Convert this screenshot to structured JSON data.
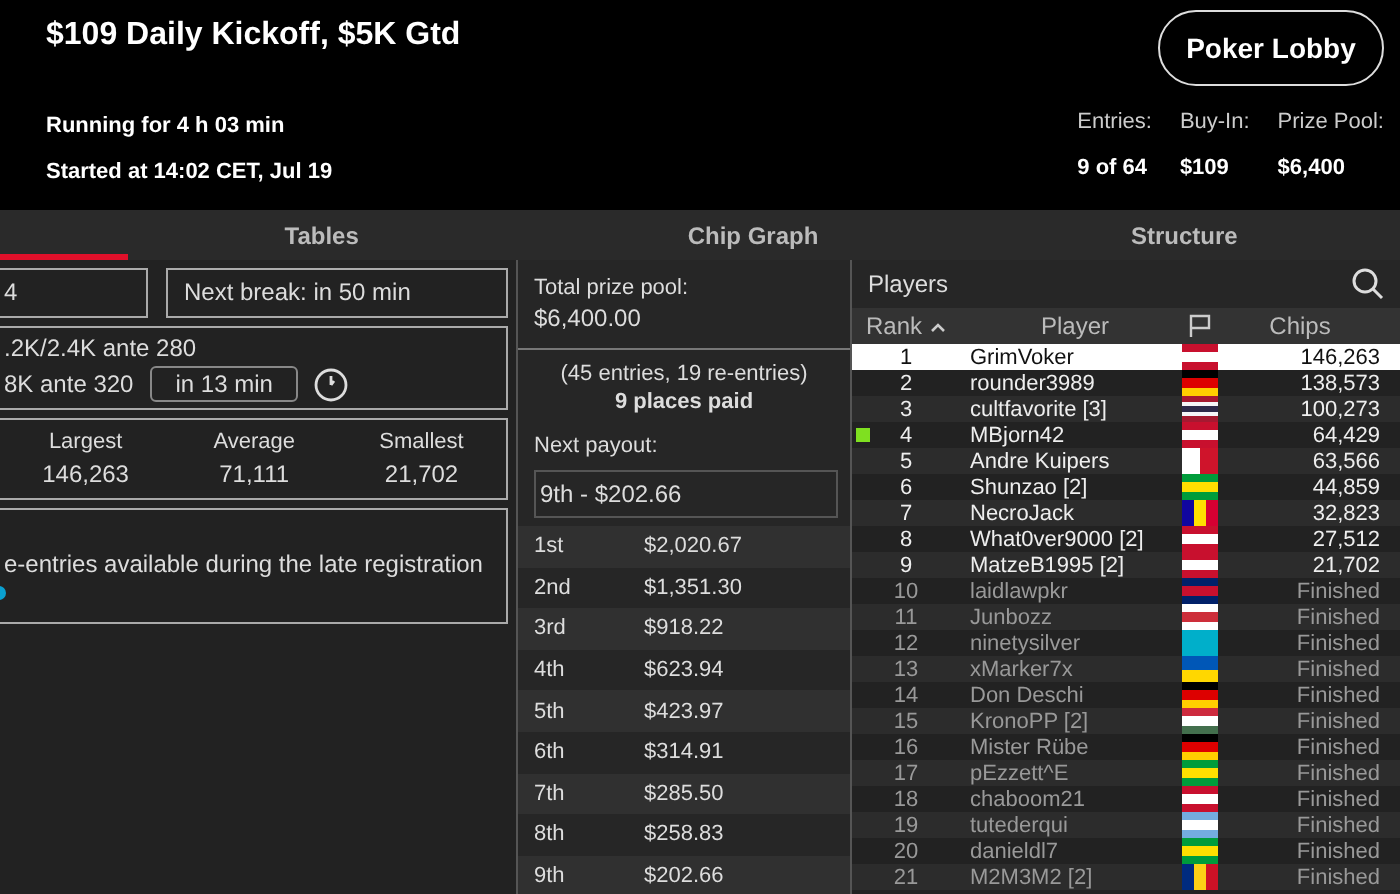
{
  "header": {
    "title": "$109 Daily Kickoff, $5K Gtd",
    "lobby_button": "Poker Lobby",
    "running": "Running for 4 h 03 min",
    "started": "Started at 14:02 CET, Jul 19",
    "stats": [
      {
        "label": "Entries:",
        "value": "9 of 64"
      },
      {
        "label": "Buy-In:",
        "value": "$109"
      },
      {
        "label": "Prize Pool:",
        "value": "$6,400"
      }
    ]
  },
  "tabs": [
    {
      "label": "Tables"
    },
    {
      "label": "Chip Graph"
    },
    {
      "label": "Structure"
    }
  ],
  "info": {
    "level": "4",
    "next_break": "Next break: in 50 min",
    "blinds_current": ".2K/2.4K ante 280",
    "blinds_next": "8K ante 320",
    "next_level_in": "in 13 min",
    "stacks": [
      {
        "label": "Largest",
        "value": "146,263"
      },
      {
        "label": "Average",
        "value": "71,111"
      },
      {
        "label": "Smallest",
        "value": "21,702"
      }
    ],
    "note": "e-entries available during the late registration"
  },
  "prizes": {
    "total_label": "Total prize pool:",
    "total": "$6,400.00",
    "entries": "(45 entries, 19 re-entries)",
    "places_paid": "9 places paid",
    "next_payout_label": "Next payout:",
    "next_payout": "9th - $202.66",
    "rows": [
      {
        "place": "1st",
        "amount": "$2,020.67"
      },
      {
        "place": "2nd",
        "amount": "$1,351.30"
      },
      {
        "place": "3rd",
        "amount": "$918.22"
      },
      {
        "place": "4th",
        "amount": "$623.94"
      },
      {
        "place": "5th",
        "amount": "$423.97"
      },
      {
        "place": "6th",
        "amount": "$314.91"
      },
      {
        "place": "7th",
        "amount": "$285.50"
      },
      {
        "place": "8th",
        "amount": "$258.83"
      },
      {
        "place": "9th",
        "amount": "$202.66"
      }
    ]
  },
  "players": {
    "title": "Players",
    "columns": [
      "Rank",
      "Player",
      "Chips"
    ],
    "rows": [
      {
        "rank": "1",
        "name": "GrimVoker",
        "chips": "146,263",
        "selected": true,
        "marked": false,
        "finished": false,
        "kind": "austria"
      },
      {
        "rank": "2",
        "name": "rounder3989",
        "chips": "138,573",
        "selected": false,
        "marked": false,
        "finished": false,
        "kind": "germany"
      },
      {
        "rank": "3",
        "name": "cultfavorite [3]",
        "chips": "100,273",
        "selected": false,
        "marked": false,
        "finished": false,
        "kind": "thailand"
      },
      {
        "rank": "4",
        "name": "MBjorn42",
        "chips": "64,429",
        "selected": false,
        "marked": true,
        "finished": false,
        "kind": "denmark"
      },
      {
        "rank": "5",
        "name": "Andre Kuipers",
        "chips": "63,566",
        "selected": false,
        "marked": false,
        "finished": false,
        "kind": "malta"
      },
      {
        "rank": "6",
        "name": "Shunzao [2]",
        "chips": "44,859",
        "selected": false,
        "marked": false,
        "finished": false,
        "kind": "brazil"
      },
      {
        "rank": "7",
        "name": "NecroJack",
        "chips": "32,823",
        "selected": false,
        "marked": false,
        "finished": false,
        "kind": "andorra"
      },
      {
        "rank": "8",
        "name": "What0ver9000 [2]",
        "chips": "27,512",
        "selected": false,
        "marked": false,
        "finished": false,
        "kind": "austria"
      },
      {
        "rank": "9",
        "name": "MatzeB1995 [2]",
        "chips": "21,702",
        "selected": false,
        "marked": false,
        "finished": false,
        "kind": "austria"
      },
      {
        "rank": "10",
        "name": "laidlawpkr",
        "chips": "Finished",
        "selected": false,
        "marked": false,
        "finished": true,
        "kind": "britain"
      },
      {
        "rank": "11",
        "name": "Junbozz",
        "chips": "Finished",
        "selected": false,
        "marked": false,
        "finished": true,
        "kind": "korea"
      },
      {
        "rank": "12",
        "name": "ninetysilver",
        "chips": "Finished",
        "selected": false,
        "marked": false,
        "finished": true,
        "kind": "kazakhstan"
      },
      {
        "rank": "13",
        "name": "xMarker7x",
        "chips": "Finished",
        "selected": false,
        "marked": false,
        "finished": true,
        "kind": "ukraine"
      },
      {
        "rank": "14",
        "name": "Don Deschi",
        "chips": "Finished",
        "selected": false,
        "marked": false,
        "finished": true,
        "kind": "germany"
      },
      {
        "rank": "15",
        "name": "KronoPP [2]",
        "chips": "Finished",
        "selected": false,
        "marked": false,
        "finished": true,
        "kind": "hungary"
      },
      {
        "rank": "16",
        "name": "Mister Rübe",
        "chips": "Finished",
        "selected": false,
        "marked": false,
        "finished": true,
        "kind": "germany"
      },
      {
        "rank": "17",
        "name": "pEzzett^E",
        "chips": "Finished",
        "selected": false,
        "marked": false,
        "finished": true,
        "kind": "brazil"
      },
      {
        "rank": "18",
        "name": "chaboom21",
        "chips": "Finished",
        "selected": false,
        "marked": false,
        "finished": true,
        "kind": "austria"
      },
      {
        "rank": "19",
        "name": "tutederqui",
        "chips": "Finished",
        "selected": false,
        "marked": false,
        "finished": true,
        "kind": "argentina"
      },
      {
        "rank": "20",
        "name": "danieldl7",
        "chips": "Finished",
        "selected": false,
        "marked": false,
        "finished": true,
        "kind": "brazil"
      },
      {
        "rank": "21",
        "name": "M2M3M2 [2]",
        "chips": "Finished",
        "selected": false,
        "marked": false,
        "finished": true,
        "kind": "romania"
      }
    ]
  }
}
